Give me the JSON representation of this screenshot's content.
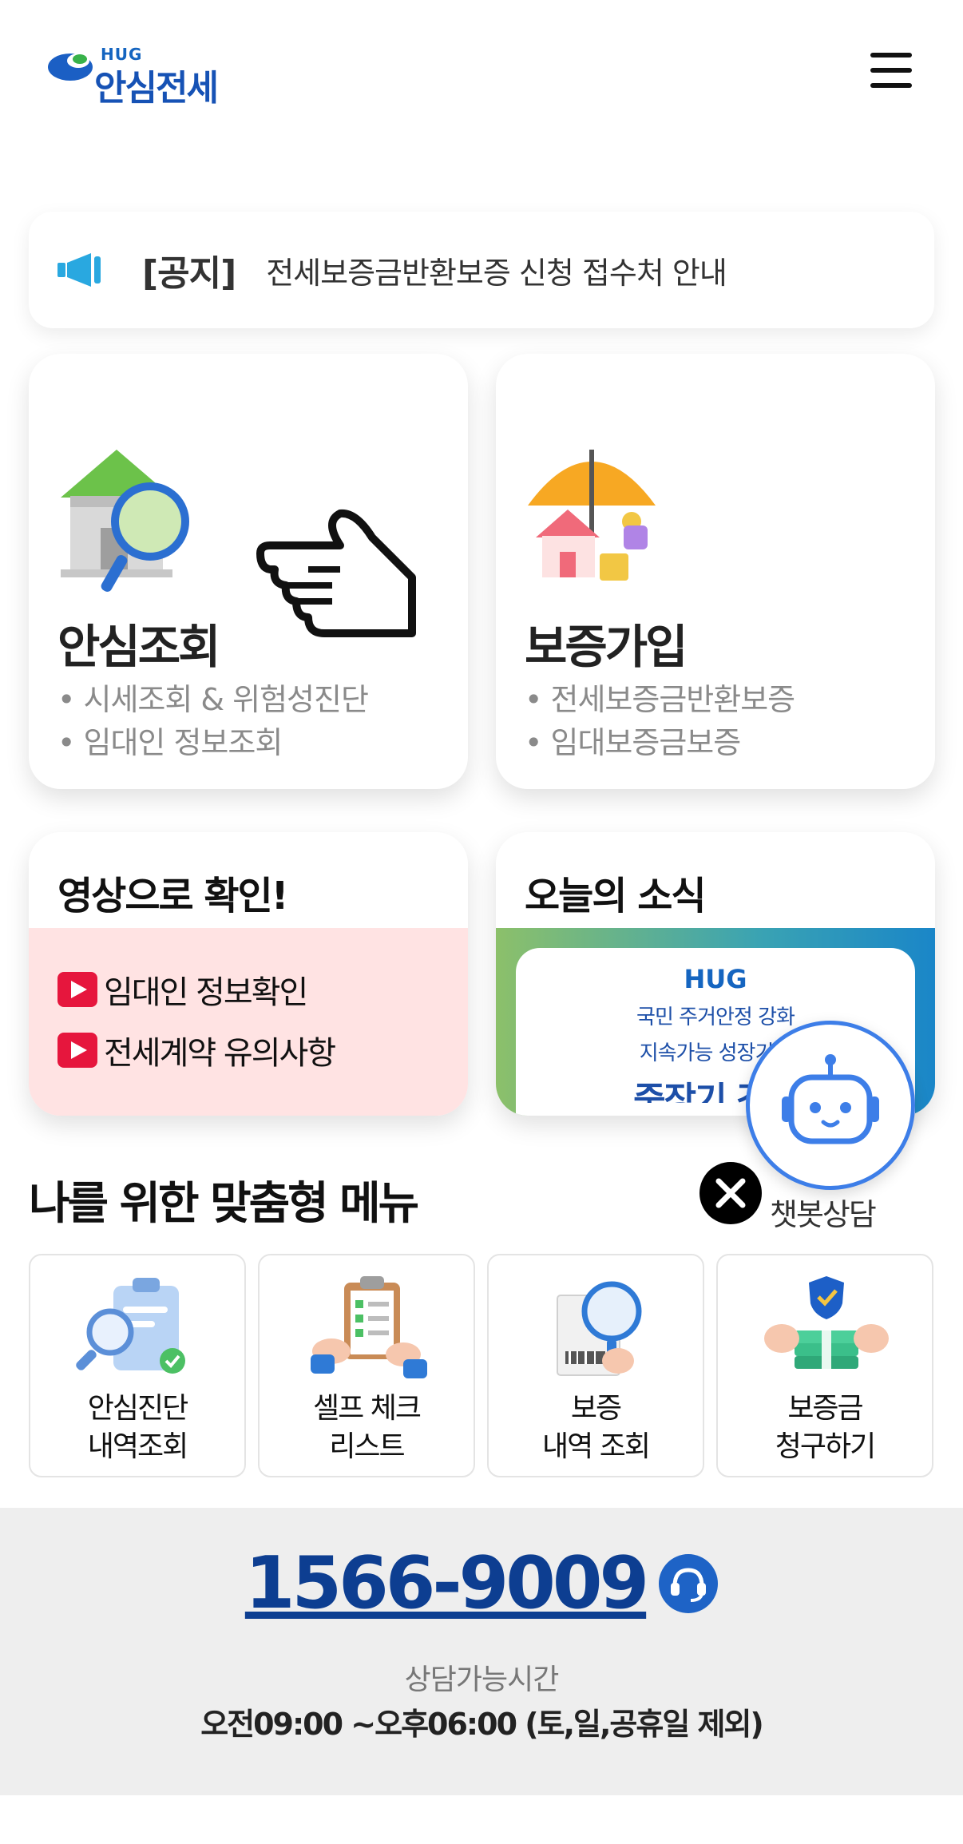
{
  "header": {
    "logo_small": "HUG",
    "logo_name": "안심전세",
    "menu_icon": "hamburger-menu-icon"
  },
  "notice": {
    "icon": "megaphone-icon",
    "tag": "[공지]",
    "text": "전세보증금반환보증 신청 접수처 안내"
  },
  "cards": [
    {
      "title": "안심조회",
      "items": [
        "• 시세조회 & 위험성진단",
        "• 임대인 정보조회"
      ],
      "icon": "house-magnifier-icon"
    },
    {
      "title": "보증가입",
      "items": [
        "• 전세보증금반환보증",
        "• 임대보증금보증"
      ],
      "icon": "umbrella-house-icon"
    }
  ],
  "video": {
    "title": "영상으로 확인!",
    "links": [
      "임대인 정보확인",
      "전세계약 유의사항"
    ]
  },
  "news": {
    "title": "오늘의 소식",
    "banner_logo": "HUG",
    "banner_line1": "국민 주거안정 강화",
    "banner_line2": "지속가능 성장기반",
    "banner_big": "중장기 경영"
  },
  "chatbot": {
    "label": "챗봇상담",
    "icon": "robot-icon"
  },
  "custom_menu": {
    "title": "나를 위한 맞춤형 메뉴",
    "tiles": [
      {
        "line1": "안심진단",
        "line2": "내역조회",
        "icon": "clipboard-check-icon"
      },
      {
        "line1": "셀프 체크",
        "line2": "리스트",
        "icon": "checklist-icon"
      },
      {
        "line1": "보증",
        "line2": "내역 조회",
        "icon": "document-search-icon"
      },
      {
        "line1": "보증금",
        "line2": "청구하기",
        "icon": "money-shield-icon"
      }
    ]
  },
  "footer": {
    "phone": "1566-9009",
    "hours_label": "상담가능시간",
    "hours": "오전09:00 ~오후06:00 (토,일,공휴일 제외)"
  },
  "colors": {
    "brand_blue": "#1652b5",
    "video_bg": "#ffe3e3",
    "play_red": "#e6163d",
    "footer_bg": "#eeeeee"
  }
}
